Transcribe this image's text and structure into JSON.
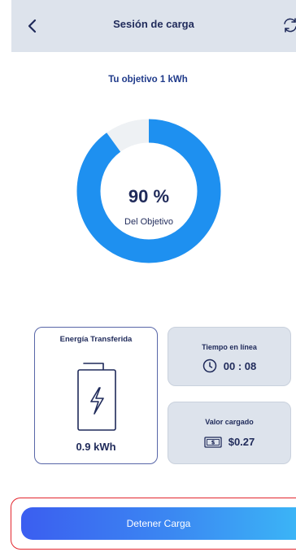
{
  "header": {
    "title": "Sesión de carga",
    "back_icon": "chevron-left-icon",
    "refresh_icon": "refresh-icon"
  },
  "goal": {
    "label": "Tu objetivo 1 kWh"
  },
  "progress": {
    "percent": 90,
    "percent_label": "90 %",
    "caption": "Del Objetivo",
    "fill_color": "#1e90f0",
    "track_color": "#eef1f4"
  },
  "energy_card": {
    "title": "Energía Transferida",
    "value": "0.9 kWh",
    "icon": "battery-charging-icon"
  },
  "time_card": {
    "title": "Tiempo en línea",
    "value": "00 : 08",
    "icon": "clock-icon"
  },
  "value_card": {
    "title": "Valor cargado",
    "value": "$0.27",
    "icon": "cash-icon"
  },
  "action": {
    "stop_label": "Detener Carga"
  },
  "colors": {
    "primary_text": "#1f2a5a",
    "header_bg": "#dde3ec",
    "highlight_border": "#e3262e"
  }
}
